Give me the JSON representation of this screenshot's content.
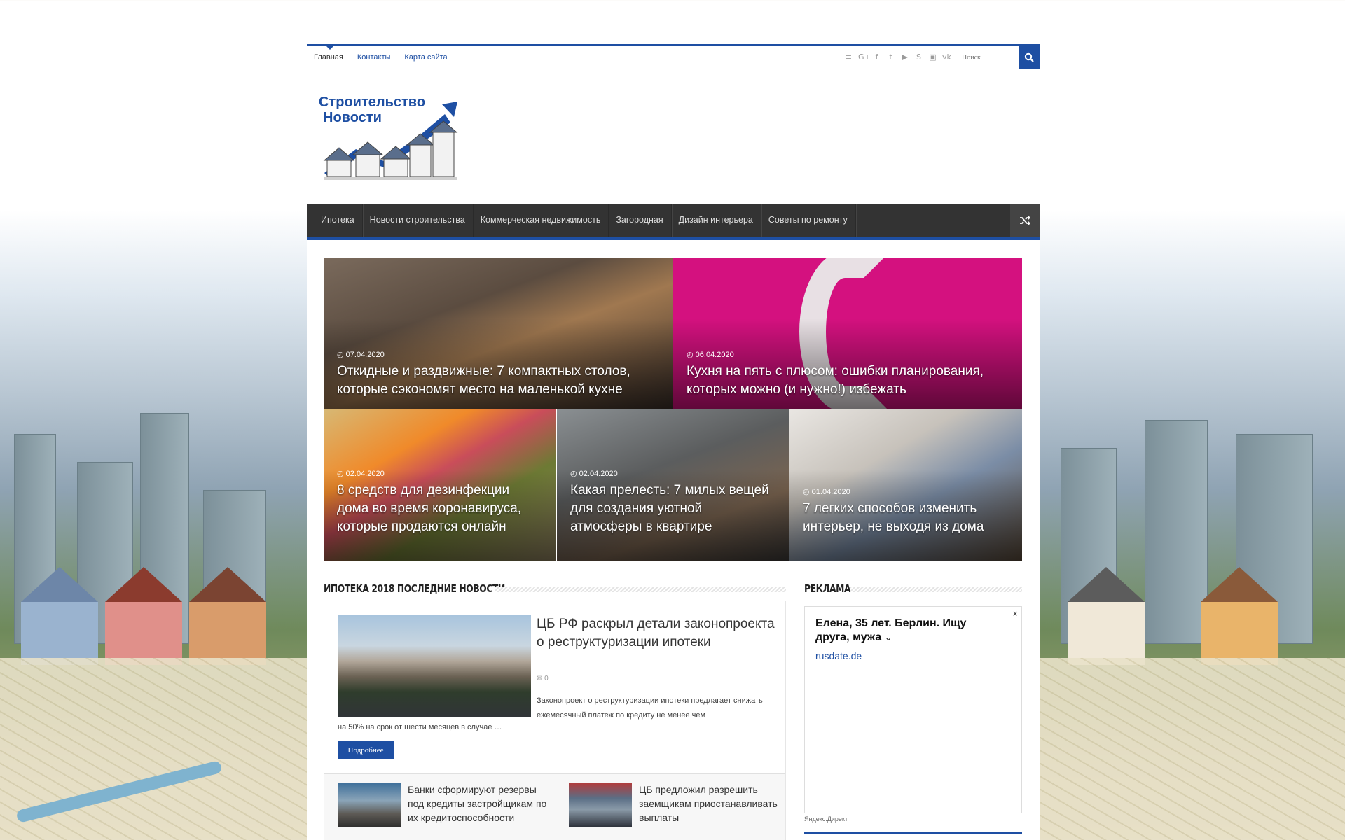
{
  "topbar": {
    "nav": [
      "Главная",
      "Контакты",
      "Карта сайта"
    ],
    "socials": [
      "rss-icon",
      "google-plus-icon",
      "facebook-icon",
      "twitter-icon",
      "youtube-icon",
      "skype-icon",
      "instagram-icon",
      "vk-icon"
    ],
    "search_placeholder": "Поиск"
  },
  "logo": {
    "line1": "Строительство",
    "line2": "Новости"
  },
  "mainnav": [
    "Ипотека",
    "Новости строительства",
    "Коммерческая недвижимость",
    "Загородная",
    "Дизайн интерьера",
    "Советы по ремонту"
  ],
  "featured": [
    {
      "date": "07.04.2020",
      "title": "Откидные и раздвижные: 7 компактных столов, которые сэкономят место на маленькой кухне"
    },
    {
      "date": "06.04.2020",
      "title": "Кухня на пять с плюсом: ошибки планирования, которых можно (и нужно!) избежать"
    },
    {
      "date": "02.04.2020",
      "title": "8 средств для дезинфекции дома во время коронавируса, которые продаются онлайн"
    },
    {
      "date": "02.04.2020",
      "title": "Какая прелесть: 7 милых вещей для создания уютной атмосферы в квартире"
    },
    {
      "date": "01.04.2020",
      "title": "7 легких способов изменить интерьер, не выходя из дома"
    }
  ],
  "news_section": {
    "title": "ИПОТЕКА 2018 ПОСЛЕДНИЕ НОВОСТИ",
    "main": {
      "title": "ЦБ РФ раскрыл детали законопроекта о реструктуризации ипотеки",
      "comments": "0",
      "excerpt_line1": "Законопроект о реструктуризации ипотеки предлагает снижать ежемесячный платеж по кредиту не менее чем",
      "excerpt_line2": "на 50% на срок от шести месяцев в случае …",
      "more": "Подробнее"
    },
    "sub": [
      {
        "title": "Банки сформируют резервы под кредиты застройщикам по их кредитоспособности"
      },
      {
        "title": "ЦБ предложил разрешить заемщикам приостанавливать выплаты"
      }
    ]
  },
  "ad_section": {
    "title": "РЕКЛАМА",
    "ad_title": "Елена, 35 лет. Берлин. Ищу друга, мужа",
    "ad_link": "rusdate.de",
    "close": "×",
    "source": "Яндекс.Директ"
  },
  "colors": {
    "accent": "#1e4fa3",
    "nav_bg": "#333333"
  }
}
